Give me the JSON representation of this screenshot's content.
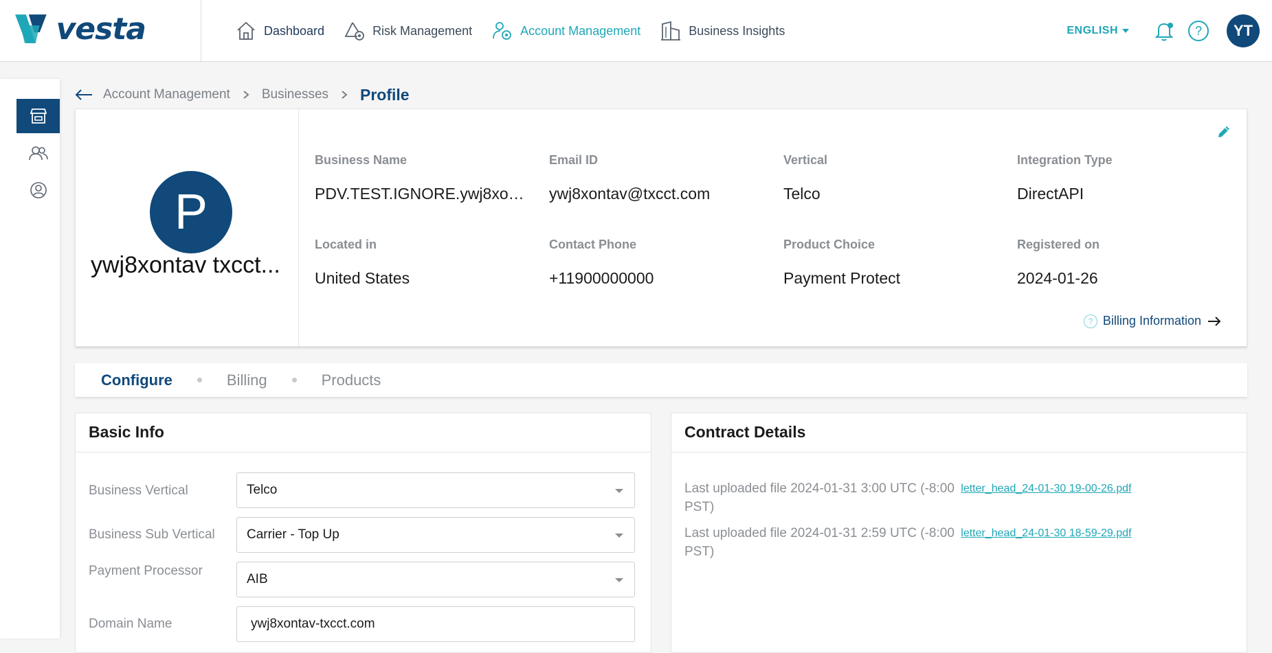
{
  "brand": {
    "name": "vesta",
    "color": "#10497a",
    "accent": "#1fa7b8"
  },
  "nav": {
    "items": [
      {
        "label": "Dashboard",
        "icon": "home-icon"
      },
      {
        "label": "Risk Management",
        "icon": "risk-shield-icon"
      },
      {
        "label": "Account Management",
        "icon": "account-gear-icon",
        "active": true
      },
      {
        "label": "Business Insights",
        "icon": "buildings-icon"
      }
    ],
    "language": "ENGLISH",
    "user_initials": "YT"
  },
  "rail": {
    "items": [
      "store-icon",
      "users-icon",
      "user-circle-icon"
    ],
    "active_index": 0
  },
  "breadcrumb": {
    "items": [
      "Account Management",
      "Businesses"
    ],
    "current": "Profile"
  },
  "profile": {
    "avatar_letter": "P",
    "display_name": "ywj8xontav txcct...",
    "fields": {
      "business_name": {
        "label": "Business Name",
        "value": "PDV.TEST.IGNORE.ywj8xon..."
      },
      "email": {
        "label": "Email ID",
        "value": "ywj8xontav@txcct.com"
      },
      "vertical": {
        "label": "Vertical",
        "value": "Telco"
      },
      "integration": {
        "label": "Integration Type",
        "value": "DirectAPI"
      },
      "located": {
        "label": "Located in",
        "value": "United States"
      },
      "phone": {
        "label": "Contact Phone",
        "value": "+11900000000"
      },
      "product": {
        "label": "Product Choice",
        "value": "Payment Protect"
      },
      "registered": {
        "label": "Registered on",
        "value": "2024-01-26"
      }
    },
    "billing_link": "Billing Information"
  },
  "tabs": {
    "items": [
      "Configure",
      "Billing",
      "Products"
    ],
    "active_index": 0
  },
  "basic_info": {
    "title": "Basic Info",
    "business_vertical": {
      "label": "Business Vertical",
      "value": "Telco"
    },
    "business_sub_vertical": {
      "label": "Business Sub Vertical",
      "value": "Carrier - Top Up"
    },
    "payment_processor": {
      "label": "Payment Processor",
      "value": "AIB"
    },
    "domain_name": {
      "label": "Domain Name",
      "value": "ywj8xontav-txcct.com"
    }
  },
  "contract": {
    "title": "Contract Details",
    "files": [
      {
        "text": "Last uploaded file 2024-01-31 3:00 UTC (-8:00 PST)",
        "link": "letter_head_24-01-30 19-00-26.pdf"
      },
      {
        "text": "Last uploaded file 2024-01-31 2:59 UTC (-8:00 PST)",
        "link": "letter_head_24-01-30 18-59-29.pdf"
      }
    ]
  }
}
